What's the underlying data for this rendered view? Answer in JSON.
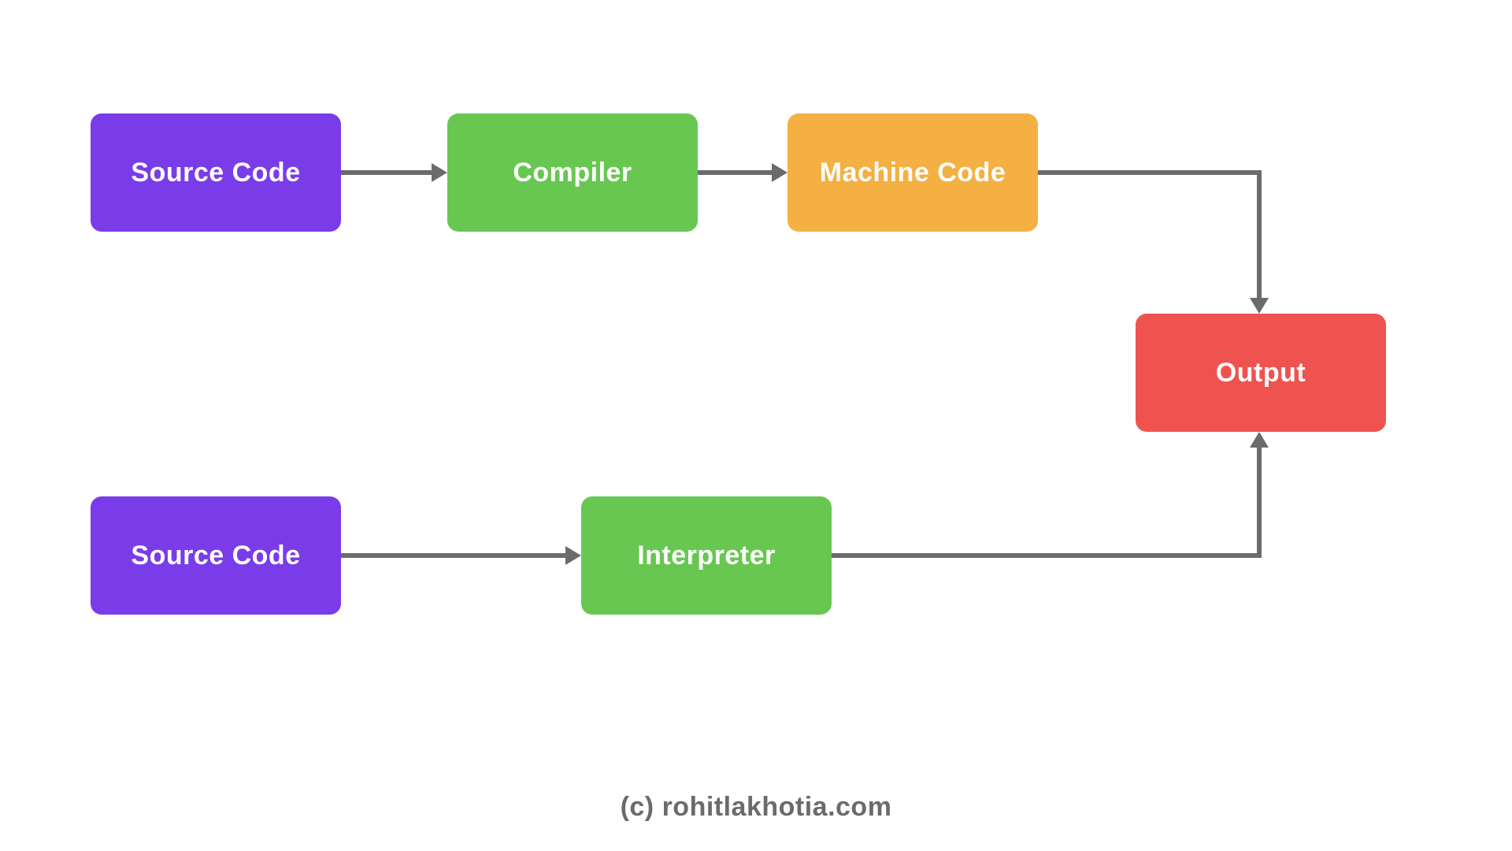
{
  "boxes": {
    "source1": {
      "label": "Source Code"
    },
    "compiler": {
      "label": "Compiler"
    },
    "machine": {
      "label": "Machine Code"
    },
    "output": {
      "label": "Output"
    },
    "source2": {
      "label": "Source Code"
    },
    "interpreter": {
      "label": "Interpreter"
    }
  },
  "credit": "(c) rohitlakhotia.com",
  "colors": {
    "purple": "#7A3CE8",
    "green": "#68C751",
    "amber": "#F4B042",
    "red": "#EF5350",
    "arrow": "#6b6b6b"
  }
}
